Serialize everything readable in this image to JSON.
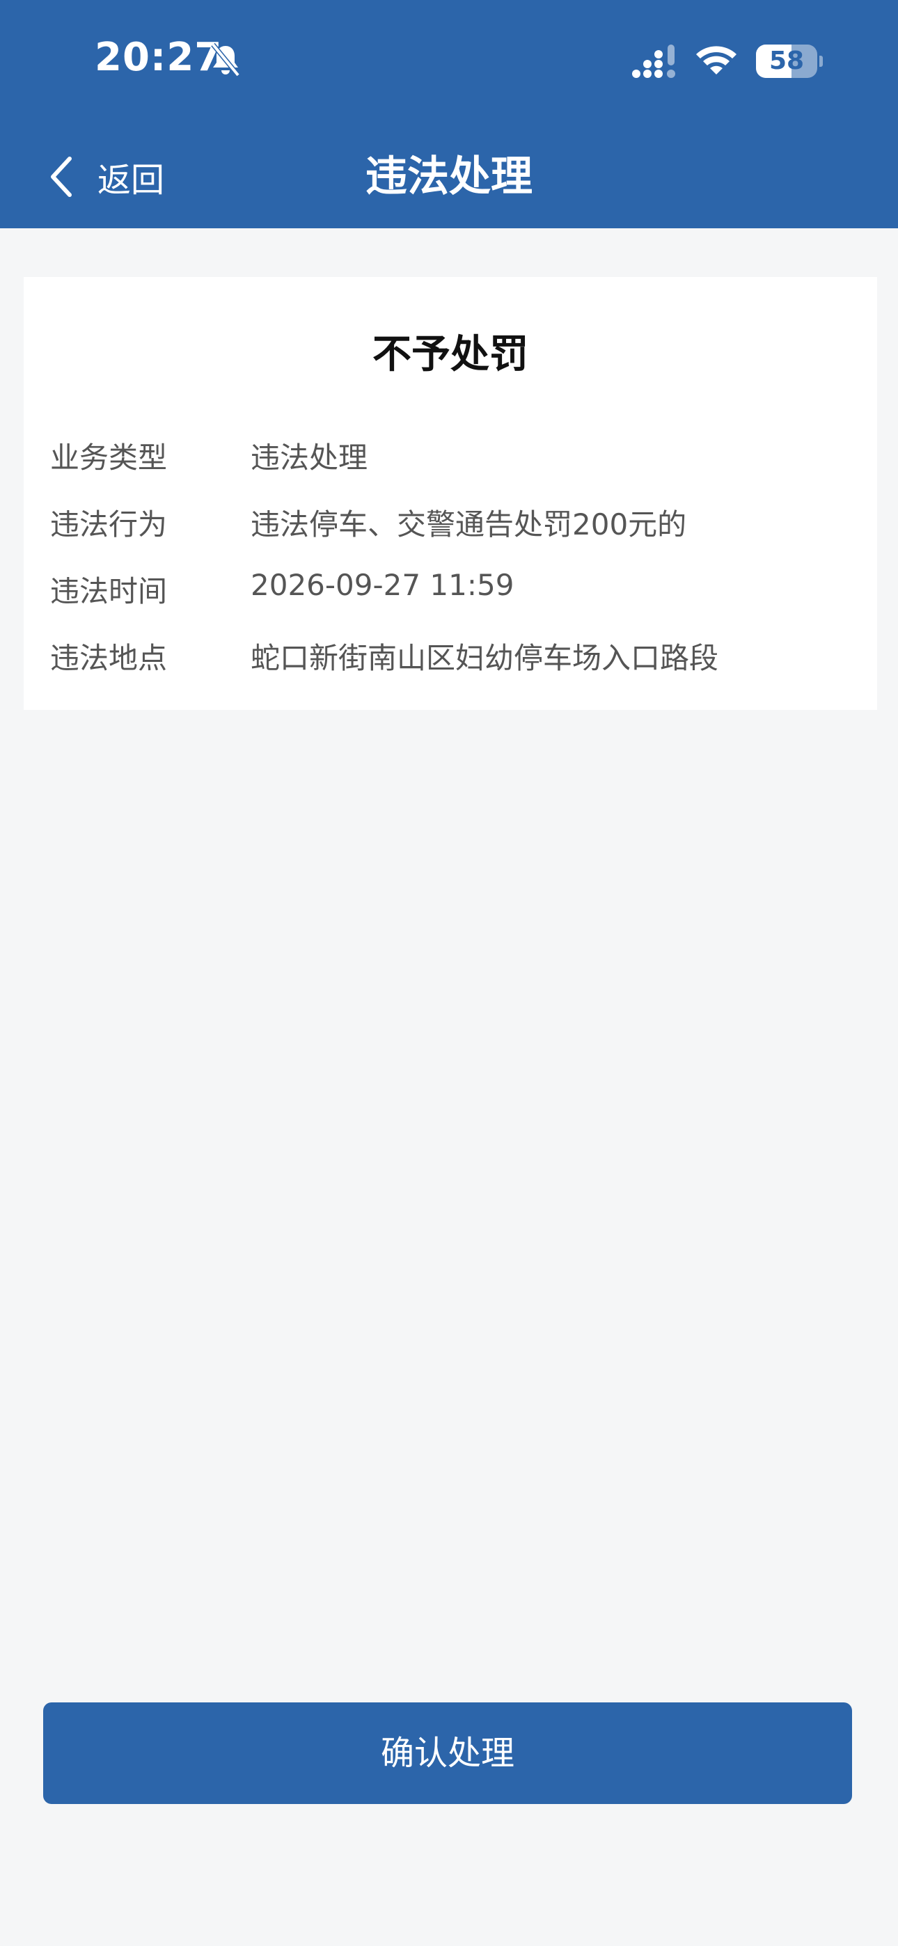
{
  "status_bar": {
    "time": "20:27",
    "battery": "58",
    "battery_level": 0.58
  },
  "nav": {
    "back_label": "返回",
    "title": "违法处理"
  },
  "card": {
    "title": "不予处罚",
    "rows": [
      {
        "label": "业务类型",
        "value": "违法处理"
      },
      {
        "label": "违法行为",
        "value": "违法停车、交警通告处罚200元的"
      },
      {
        "label": "违法时间",
        "value": "2026-09-27 11:59"
      },
      {
        "label": "违法地点",
        "value": "蛇口新街南山区妇幼停车场入口路段"
      }
    ]
  },
  "confirm_button": "确认处理",
  "colors": {
    "brand": "#2c65aa",
    "background": "#f5f6f7"
  }
}
